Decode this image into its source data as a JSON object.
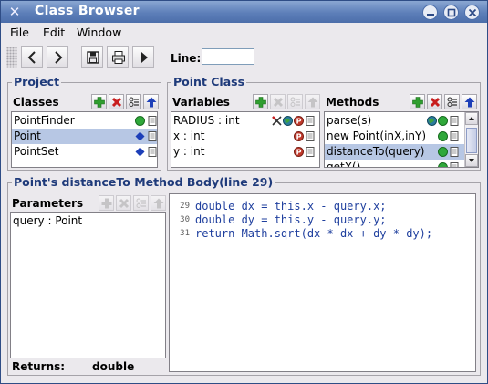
{
  "window": {
    "title": "Class Browser",
    "app_icon": "x-tools-icon"
  },
  "menu": [
    "File",
    "Edit",
    "Window"
  ],
  "toolbar": {
    "buttons": [
      "back-arrow-icon",
      "forward-arrow-icon",
      "save-disk-icon",
      "print-icon",
      "run-icon"
    ],
    "line_label": "Line:",
    "line_value": ""
  },
  "project": {
    "title": "Project",
    "classes_label": "Classes",
    "classes": [
      {
        "name": "PointFinder",
        "selected": false
      },
      {
        "name": "Point",
        "selected": true
      },
      {
        "name": "PointSet",
        "selected": false
      }
    ]
  },
  "point_class": {
    "title": "Point Class",
    "variables_label": "Variables",
    "variables": [
      {
        "name": "RADIUS : int"
      },
      {
        "name": "x : int"
      },
      {
        "name": "y : int"
      }
    ],
    "methods_label": "Methods",
    "methods": [
      {
        "name": "parse(s)",
        "selected": false
      },
      {
        "name": "new Point(inX,inY)",
        "selected": false
      },
      {
        "name": "distanceTo(query)",
        "selected": true
      },
      {
        "name": "getX()",
        "selected": false
      }
    ]
  },
  "method_body": {
    "title": "Point's distanceTo Method Body(line 29)",
    "parameters_label": "Parameters",
    "parameters": [
      "query : Point"
    ],
    "returns_label": "Returns:",
    "returns_value": "double",
    "code_lines": [
      {
        "num": "29",
        "text": "double dx = this.x - query.x;"
      },
      {
        "num": "30",
        "text": "double dy = this.y - query.y;"
      },
      {
        "num": "31",
        "text": "return Math.sqrt(dx * dx + dy * dy);"
      }
    ]
  },
  "colors": {
    "title_bar": "#5d7fb9",
    "section_title": "#1e3a7a",
    "selection": "#b7c7e4",
    "code_text": "#1f3f9e",
    "add_green": "#2f9e2f",
    "delete_red": "#c81e1e",
    "static_red": "#c0392b",
    "public_green": "#2fa83a",
    "class_blue": "#1d3fb8"
  }
}
